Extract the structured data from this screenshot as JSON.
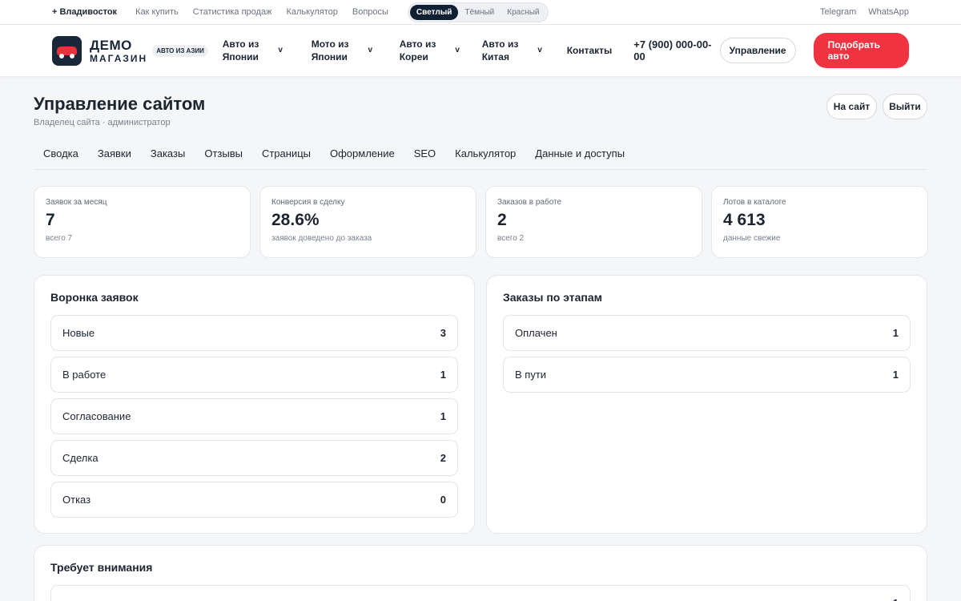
{
  "topbar": {
    "city": "+ Владивосток",
    "links": [
      "Как купить",
      "Статистика продаж",
      "Калькулятор",
      "Вопросы"
    ],
    "themes": [
      "Светлый",
      "Тёмный",
      "Красный"
    ],
    "active_theme": "Светлый",
    "right_links": [
      "Telegram",
      "WhatsApp"
    ]
  },
  "header": {
    "logo_line1": "ДЕМО",
    "logo_line2": "МАГАЗИН",
    "logo_badge": "АВТО ИЗ АЗИИ",
    "nav": [
      {
        "line1": "Авто из",
        "line2": "Японии"
      },
      {
        "line1": "Мото из",
        "line2": "Японии"
      },
      {
        "line1": "Авто из",
        "line2": "Кореи"
      },
      {
        "line1": "Авто из",
        "line2": "Китая"
      }
    ],
    "chevron": "v",
    "contacts": "Контакты",
    "phone": "+7 (900) 000-00-00",
    "manage_button": "Управление",
    "pick_button": "Подобрать авто"
  },
  "page": {
    "title": "Управление сайтом",
    "subtitle": "Владелец сайта · администратор",
    "to_site_button": "На сайт",
    "logout_button": "Выйти"
  },
  "tabs": [
    "Сводка",
    "Заявки",
    "Заказы",
    "Отзывы",
    "Страницы",
    "Оформление",
    "SEO",
    "Калькулятор",
    "Данные и доступы"
  ],
  "stats": [
    {
      "label": "Заявок за месяц",
      "value": "7",
      "sub": "всего 7"
    },
    {
      "label": "Конверсия в сделку",
      "value": "28.6%",
      "sub": "заявок доведено до заказа"
    },
    {
      "label": "Заказов в работе",
      "value": "2",
      "sub": "всего 2"
    },
    {
      "label": "Лотов в каталоге",
      "value": "4 613",
      "sub": "данные свежие"
    }
  ],
  "funnel": {
    "title": "Воронка заявок",
    "rows": [
      {
        "label": "Новые",
        "count": "3"
      },
      {
        "label": "В работе",
        "count": "1"
      },
      {
        "label": "Согласование",
        "count": "1"
      },
      {
        "label": "Сделка",
        "count": "2"
      },
      {
        "label": "Отказ",
        "count": "0"
      }
    ]
  },
  "orders": {
    "title": "Заказы по этапам",
    "rows": [
      {
        "label": "Оплачен",
        "count": "1"
      },
      {
        "label": "В пути",
        "count": "1"
      }
    ]
  },
  "attention": {
    "title": "Требует внимания",
    "rows": [
      {
        "label": "",
        "count": "1"
      }
    ]
  },
  "colors": {
    "accent_red": "#ef3340",
    "dark_navy": "#0f2033"
  }
}
